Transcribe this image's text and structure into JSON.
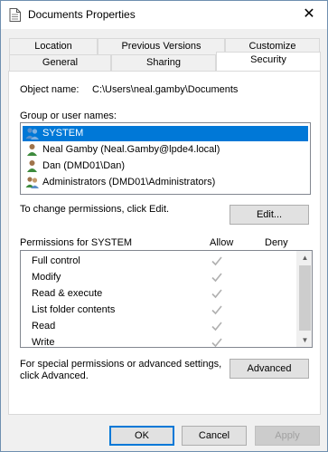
{
  "window": {
    "title": "Documents Properties",
    "close_glyph": "✕"
  },
  "tabs": {
    "row_back": [
      "Location",
      "Previous Versions",
      "Customize"
    ],
    "row_front": [
      "General",
      "Sharing",
      "Security"
    ],
    "active": "Security"
  },
  "security": {
    "object_name_label": "Object name:",
    "object_name_value": "C:\\Users\\neal.gamby\\Documents",
    "group_label": "Group or user names:",
    "users": [
      {
        "name": "SYSTEM",
        "icon": "group-icon",
        "selected": true
      },
      {
        "name": "Neal Gamby (Neal.Gamby@lpde4.local)",
        "icon": "user-icon",
        "selected": false
      },
      {
        "name": "Dan (DMD01\\Dan)",
        "icon": "user-icon",
        "selected": false
      },
      {
        "name": "Administrators (DMD01\\Administrators)",
        "icon": "group-icon",
        "selected": false
      }
    ],
    "change_text": "To change permissions, click Edit.",
    "edit_button": "Edit...",
    "permissions_header": "Permissions for SYSTEM",
    "allow_header": "Allow",
    "deny_header": "Deny",
    "permissions": [
      {
        "name": "Full control",
        "allow": true,
        "deny": false
      },
      {
        "name": "Modify",
        "allow": true,
        "deny": false
      },
      {
        "name": "Read & execute",
        "allow": true,
        "deny": false
      },
      {
        "name": "List folder contents",
        "allow": true,
        "deny": false
      },
      {
        "name": "Read",
        "allow": true,
        "deny": false
      },
      {
        "name": "Write",
        "allow": true,
        "deny": false
      }
    ],
    "special_text_1": "For special permissions or advanced settings,",
    "special_text_2": "click Advanced.",
    "advanced_button": "Advanced"
  },
  "footer": {
    "ok": "OK",
    "cancel": "Cancel",
    "apply": "Apply"
  },
  "colors": {
    "selection": "#0078d7",
    "check": "#b0b0b0"
  }
}
